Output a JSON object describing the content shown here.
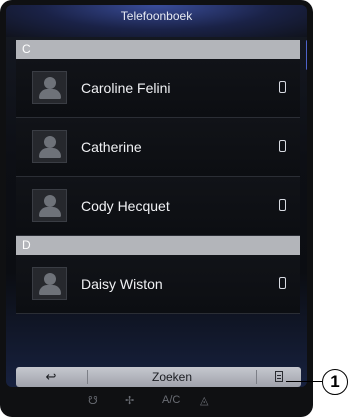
{
  "header": {
    "title": "Telefoonboek"
  },
  "sections": [
    {
      "letter": "C",
      "contacts": [
        "Caroline Felini",
        "Catherine",
        "Cody Hecquet"
      ]
    },
    {
      "letter": "D",
      "contacts": [
        "Daisy Wiston"
      ]
    }
  ],
  "toolbar": {
    "back_icon": "↩",
    "search_label": "Zoeken",
    "menu_icon": "list-icon"
  },
  "bottom_icons": [
    "seat-heat-icon",
    "fan-icon",
    "A/C",
    "defrost-icon"
  ],
  "callout": {
    "label": "1"
  },
  "colors": {
    "accent": "#4e63c9",
    "section_bg": "#b3b5ba",
    "toolbar_bg": "#c6c8cf"
  }
}
